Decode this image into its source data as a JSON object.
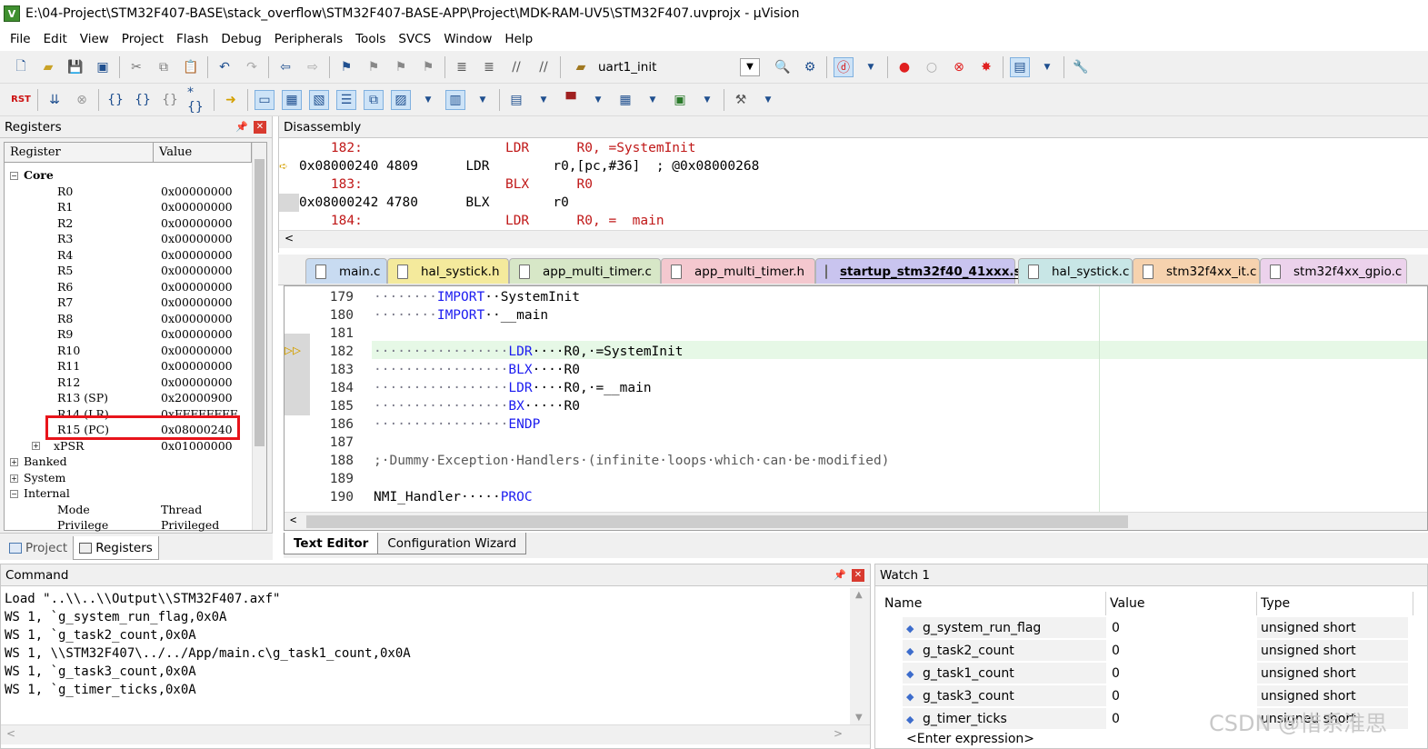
{
  "title": "E:\\04-Project\\STM32F407-BASE\\stack_overflow\\STM32F407-BASE-APP\\Project\\MDK-RAM-UV5\\STM32F407.uvprojx - µVision",
  "menu": [
    "File",
    "Edit",
    "View",
    "Project",
    "Flash",
    "Debug",
    "Peripherals",
    "Tools",
    "SVCS",
    "Window",
    "Help"
  ],
  "toolbar": {
    "target_function": "uart1_init"
  },
  "registers": {
    "panel_title": "Registers",
    "col_register": "Register",
    "col_value": "Value",
    "core_label": "Core",
    "rows": [
      {
        "name": "R0",
        "value": "0x00000000"
      },
      {
        "name": "R1",
        "value": "0x00000000"
      },
      {
        "name": "R2",
        "value": "0x00000000"
      },
      {
        "name": "R3",
        "value": "0x00000000"
      },
      {
        "name": "R4",
        "value": "0x00000000"
      },
      {
        "name": "R5",
        "value": "0x00000000"
      },
      {
        "name": "R6",
        "value": "0x00000000"
      },
      {
        "name": "R7",
        "value": "0x00000000"
      },
      {
        "name": "R8",
        "value": "0x00000000"
      },
      {
        "name": "R9",
        "value": "0x00000000"
      },
      {
        "name": "R10",
        "value": "0x00000000"
      },
      {
        "name": "R11",
        "value": "0x00000000"
      },
      {
        "name": "R12",
        "value": "0x00000000"
      },
      {
        "name": "R13 (SP)",
        "value": "0x20000900"
      },
      {
        "name": "R14 (LR)",
        "value": "0xFFFFFFFF"
      },
      {
        "name": "R15 (PC)",
        "value": "0x08000240"
      },
      {
        "name": "xPSR",
        "value": "0x01000000"
      }
    ],
    "groups": [
      "Banked",
      "System",
      "Internal"
    ],
    "internal_rows": [
      {
        "name": "Mode",
        "value": "Thread"
      },
      {
        "name": "Privilege",
        "value": "Privileged"
      }
    ],
    "highlight_color": "#e8141b"
  },
  "left_tabs": [
    "Project",
    "Registers"
  ],
  "disassembly": {
    "panel_title": "Disassembly",
    "lines": [
      "    182:                  LDR      R0, =SystemInit",
      "0x08000240 4809      LDR        r0,[pc,#36]  ; @0x08000268",
      "    183:                  BLX      R0",
      "0x08000242 4780      BLX        r0",
      "    184:                  LDR      R0, =  main"
    ]
  },
  "file_tabs": [
    "main.c",
    "hal_systick.h",
    "app_multi_timer.c",
    "app_multi_timer.h",
    "startup_stm32f40_41xxx.s",
    "hal_systick.c",
    "stm32f4xx_it.c",
    "stm32f4xx_gpio.c"
  ],
  "editor": {
    "lines": [
      {
        "n": "179",
        "dots": "········",
        "kw": "IMPORT",
        "rest": "··SystemInit",
        "cm": ""
      },
      {
        "n": "180",
        "dots": "········",
        "kw": "IMPORT",
        "rest": "··__main",
        "cm": ""
      },
      {
        "n": "181",
        "dots": "",
        "kw": "",
        "rest": "",
        "cm": ""
      },
      {
        "n": "182",
        "dots": "·················",
        "kw": "LDR",
        "rest": "····R0,·=SystemInit",
        "cm": ""
      },
      {
        "n": "183",
        "dots": "·················",
        "kw": "BLX",
        "rest": "····R0",
        "cm": ""
      },
      {
        "n": "184",
        "dots": "·················",
        "kw": "LDR",
        "rest": "····R0,·=__main",
        "cm": ""
      },
      {
        "n": "185",
        "dots": "·················",
        "kw": "BX",
        "rest": "·····R0",
        "cm": ""
      },
      {
        "n": "186",
        "dots": "·················",
        "kw": "ENDP",
        "rest": "",
        "cm": ""
      },
      {
        "n": "187",
        "dots": "",
        "kw": "",
        "rest": "",
        "cm": ""
      },
      {
        "n": "188",
        "dots": "",
        "kw": "",
        "rest": "",
        "cm": ";·Dummy·Exception·Handlers·(infinite·loops·which·can·be·modified)"
      },
      {
        "n": "189",
        "dots": "",
        "kw": "",
        "rest": "",
        "cm": ""
      },
      {
        "n": "190",
        "dots": "",
        "kw": "",
        "rest": "NMI_Handler·····",
        "kw2": "PROC",
        "cm": ""
      }
    ],
    "bottom_tabs": [
      "Text Editor",
      "Configuration Wizard"
    ]
  },
  "command": {
    "panel_title": "Command",
    "lines": [
      "Load \"..\\\\..\\\\Output\\\\STM32F407.axf\"",
      "WS 1, `g_system_run_flag,0x0A",
      "WS 1, `g_task2_count,0x0A",
      "WS 1, \\\\STM32F407\\../../App/main.c\\g_task1_count,0x0A",
      "WS 1, `g_task3_count,0x0A",
      "WS 1, `g_timer_ticks,0x0A"
    ]
  },
  "watch": {
    "panel_title": "Watch 1",
    "col_name": "Name",
    "col_value": "Value",
    "col_type": "Type",
    "rows": [
      {
        "name": "g_system_run_flag",
        "value": "0",
        "type": "unsigned short"
      },
      {
        "name": "g_task2_count",
        "value": "0",
        "type": "unsigned short"
      },
      {
        "name": "g_task1_count",
        "value": "0",
        "type": "unsigned short"
      },
      {
        "name": "g_task3_count",
        "value": "0",
        "type": "unsigned short"
      },
      {
        "name": "g_timer_ticks",
        "value": "0",
        "type": "unsigned short"
      }
    ],
    "enter_expression": "<Enter expression>"
  },
  "watermark": "CSDN @惜系淮思"
}
